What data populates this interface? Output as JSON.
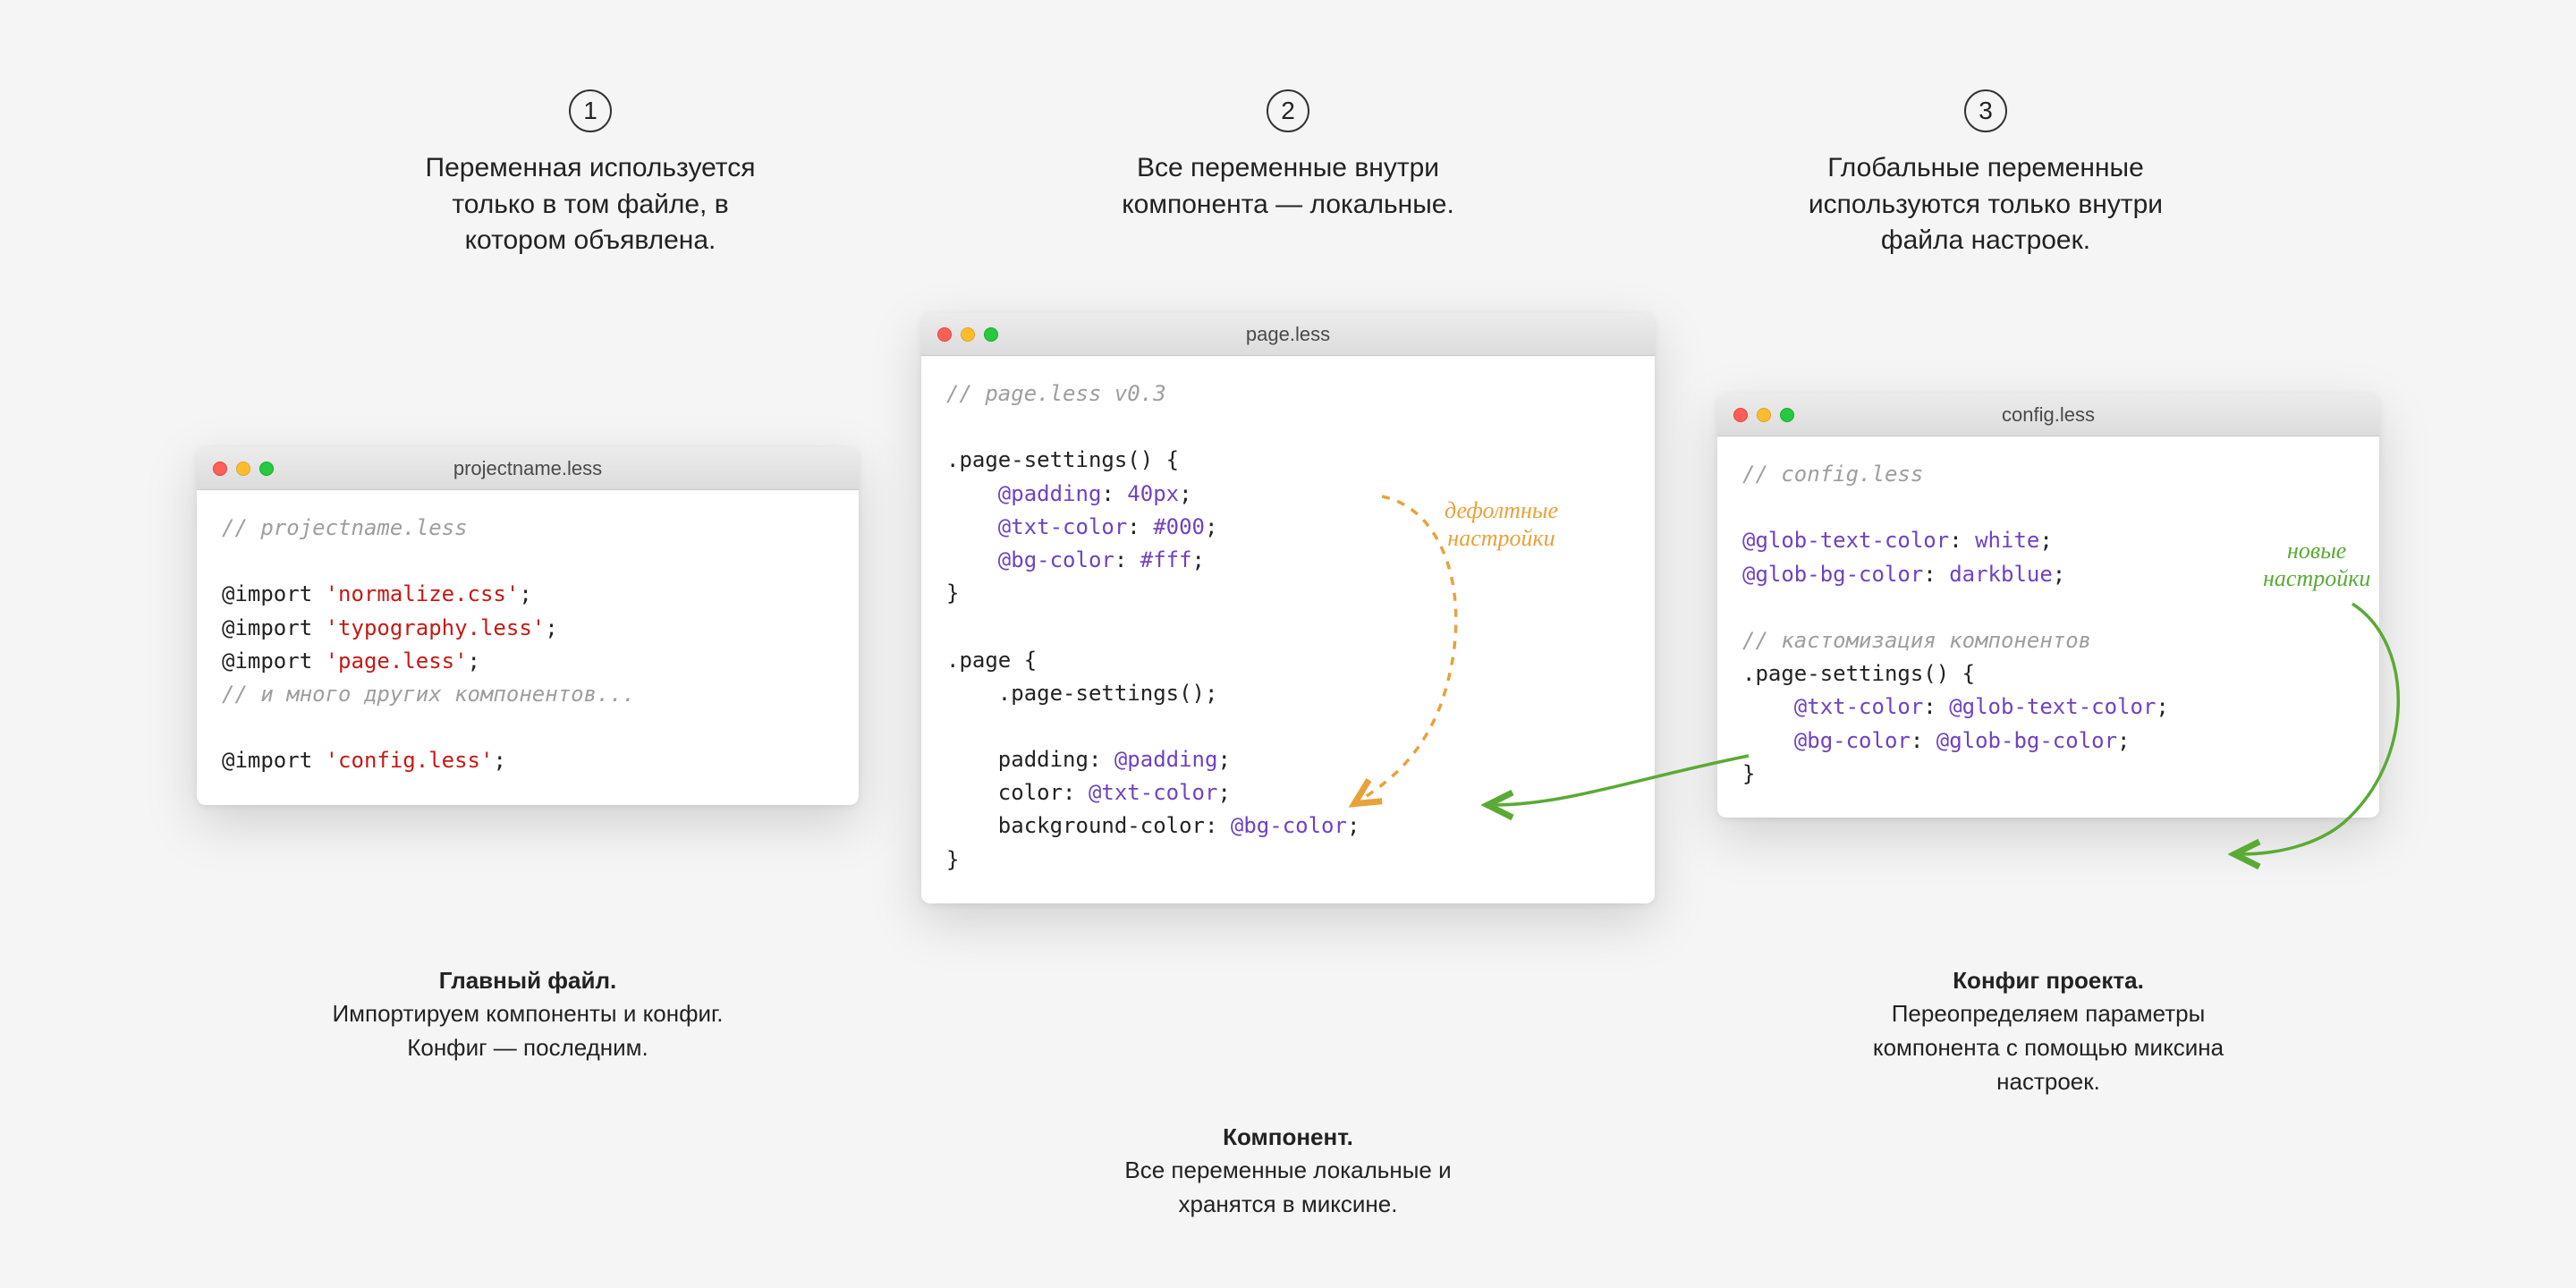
{
  "steps": [
    {
      "num": "1",
      "desc": "Переменная используется\nтолько в том файле, в\nкотором объявлена."
    },
    {
      "num": "2",
      "desc": "Все переменные внутри\nкомпонента — локальные."
    },
    {
      "num": "3",
      "desc": "Глобальные переменные\nиспользуются только внутри\nфайла настроек."
    }
  ],
  "win1": {
    "title": "projectname.less",
    "c0": "// projectname.less",
    "l0a": "@import ",
    "l0b": "'normalize.css'",
    "l0c": ";",
    "l1a": "@import ",
    "l1b": "'typography.less'",
    "l1c": ";",
    "l2a": "@import ",
    "l2b": "'page.less'",
    "l2c": ";",
    "c1": "// и много других компонентов...",
    "l3a": "@import ",
    "l3b": "'config.less'",
    "l3c": ";"
  },
  "win2": {
    "title": "page.less",
    "c0": "// page.less v0.3",
    "s0": ".page-settings() {",
    "v0a": "    @padding",
    "v0b": ": ",
    "v0c": "40px",
    "v0d": ";",
    "v1a": "    @txt-color",
    "v1b": ": ",
    "v1c": "#000",
    "v1d": ";",
    "v2a": "    @bg-color",
    "v2b": ": ",
    "v2c": "#fff",
    "v2d": ";",
    "s1": "}",
    "p0": ".page {",
    "p1": "    .page-settings();",
    "p2a": "    padding: ",
    "p2b": "@padding",
    "p2c": ";",
    "p3a": "    color: ",
    "p3b": "@txt-color",
    "p3c": ";",
    "p4a": "    background-color: ",
    "p4b": "@bg-color",
    "p4c": ";",
    "p5": "}"
  },
  "win3": {
    "title": "config.less",
    "c0": "// config.less",
    "g0a": "@glob-text-color",
    "g0b": ": ",
    "g0c": "white",
    "g0d": ";",
    "g1a": "@glob-bg-color",
    "g1b": ": ",
    "g1c": "darkblue",
    "g1d": ";",
    "c1": "// кастомизация компонентов",
    "s0": ".page-settings() {",
    "o0a": "    @txt-color",
    "o0b": ": ",
    "o0c": "@glob-text-color",
    "o0d": ";",
    "o1a": "    @bg-color",
    "o1b": ": ",
    "o1c": "@glob-bg-color",
    "o1d": ";",
    "s1": "}"
  },
  "notes": {
    "default": "дефолтные\nнастройки",
    "new": "новые\nнастройки"
  },
  "captions": {
    "c1_title": "Главный файл.",
    "c1_body": "Импортируем компоненты и конфиг.\nКонфиг — последним.",
    "c2_title": "Компонент.",
    "c2_body": "Все переменные локальные и\nхранятся в миксине.",
    "c3_title": "Конфиг проекта.",
    "c3_body": "Переопределяем параметры\nкомпонента с помощью миксина\nнастроек."
  }
}
